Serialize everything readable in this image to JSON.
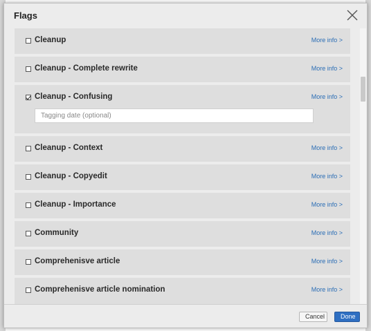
{
  "dialog": {
    "title": "Flags",
    "close_icon": "close-icon"
  },
  "flags": [
    {
      "label": "Cleanup",
      "checked": false,
      "more_info": "More info >"
    },
    {
      "label": "Cleanup - Complete rewrite",
      "checked": false,
      "more_info": "More info >"
    },
    {
      "label": "Cleanup - Confusing",
      "checked": true,
      "more_info": "More info >",
      "date_placeholder": "Tagging date (optional)",
      "date_value": ""
    },
    {
      "label": "Cleanup - Context",
      "checked": false,
      "more_info": "More info >"
    },
    {
      "label": "Cleanup - Copyedit",
      "checked": false,
      "more_info": "More info >"
    },
    {
      "label": "Cleanup - Importance",
      "checked": false,
      "more_info": "More info >"
    },
    {
      "label": "Community",
      "checked": false,
      "more_info": "More info >"
    },
    {
      "label": "Comprehenisve article",
      "checked": false,
      "more_info": "More info >"
    },
    {
      "label": "Comprehenisve article nomination",
      "checked": false,
      "more_info": "More info >"
    }
  ],
  "footer": {
    "cancel_label": "Cancel",
    "done_label": "Done"
  },
  "colors": {
    "link": "#2a6db5",
    "primary_button": "#2f6fc2",
    "item_background": "#dedede"
  }
}
